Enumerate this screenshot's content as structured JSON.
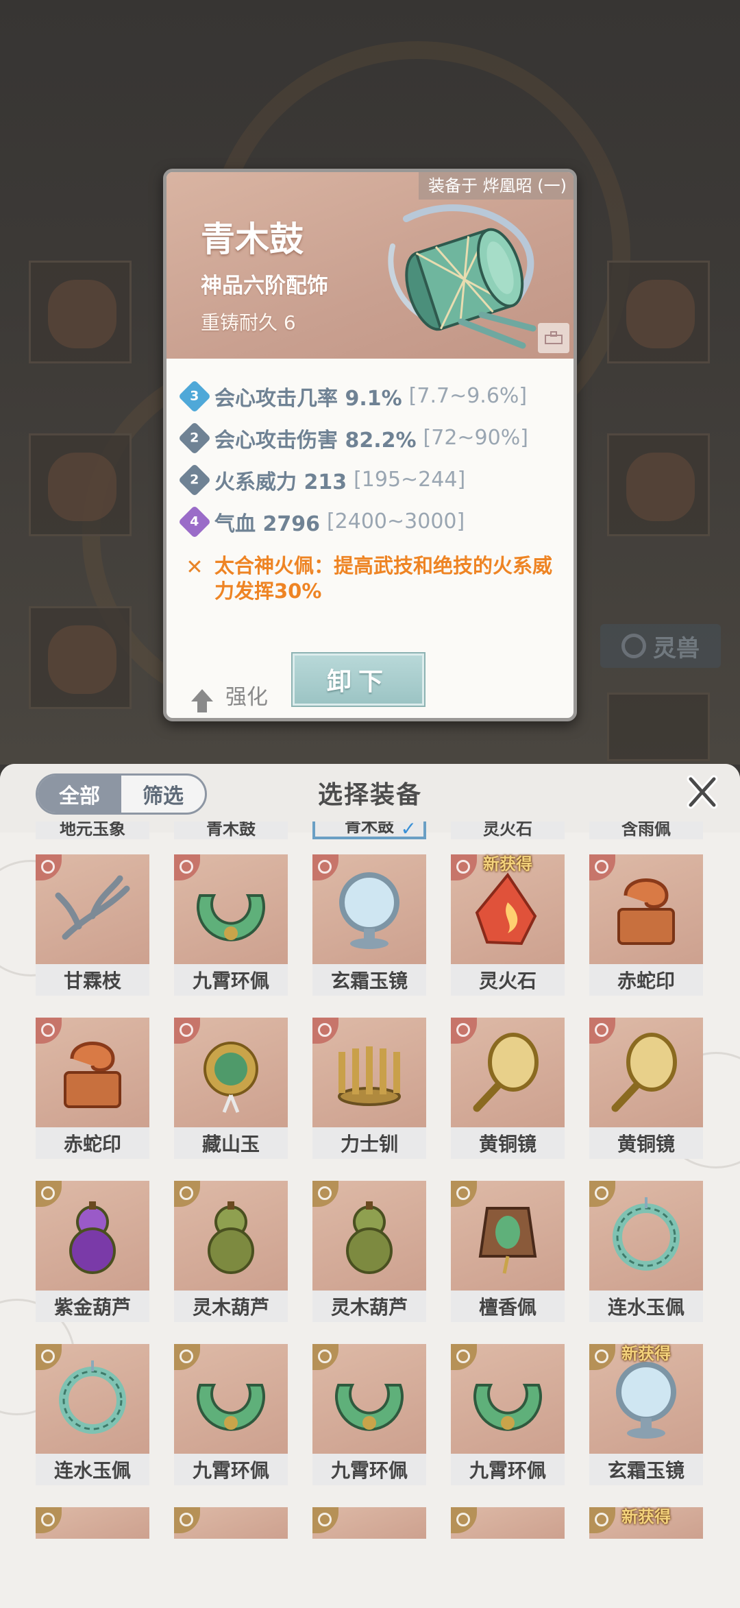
{
  "background": {
    "side_tab": {
      "label": "灵兽"
    }
  },
  "detail": {
    "equipped_on": "装备于 烨凰昭 (一)",
    "name": "青木鼓",
    "grade": "神品六阶配饰",
    "durability": "重铸耐久 6",
    "icon": "drum-icon",
    "stats": [
      {
        "level": "3",
        "color": "#4fa8d8",
        "value": "会心攻击几率 9.1%",
        "range": "[7.7~9.6%]"
      },
      {
        "level": "2",
        "color": "#6f8294",
        "value": "会心攻击伤害 82.2%",
        "range": "[72~90%]"
      },
      {
        "level": "2",
        "color": "#6f8294",
        "value": "火系威力 213",
        "range": "[195~244]"
      },
      {
        "level": "4",
        "color": "#9a6cc8",
        "value": "气血 2796",
        "range": "[2400~3000]"
      }
    ],
    "special_effect": "太合神火佩：提高武技和绝技的火系威力发挥30%",
    "enhance_label": "强化",
    "unequip_label": "卸下"
  },
  "panel": {
    "title": "选择装备",
    "filter_all": "全部",
    "filter_filter": "筛选",
    "top_row": [
      {
        "name": "地元玉象",
        "selected": false
      },
      {
        "name": "青木鼓",
        "selected": false
      },
      {
        "name": "青木鼓",
        "selected": true
      },
      {
        "name": "灵火石",
        "selected": false
      },
      {
        "name": "含雨佩",
        "selected": false
      }
    ],
    "rows": [
      [
        {
          "name": "甘霖枝",
          "badge": "red",
          "icon": "branch-icon",
          "new": ""
        },
        {
          "name": "九霄环佩",
          "badge": "red",
          "icon": "jade-ring-icon",
          "new": ""
        },
        {
          "name": "玄霜玉镜",
          "badge": "red",
          "icon": "mirror-icon",
          "new": ""
        },
        {
          "name": "灵火石",
          "badge": "red",
          "icon": "fire-stone-icon",
          "new": "新获得"
        },
        {
          "name": "赤蛇印",
          "badge": "red",
          "icon": "snake-seal-icon",
          "new": ""
        }
      ],
      [
        {
          "name": "赤蛇印",
          "badge": "red",
          "icon": "snake-seal-icon",
          "new": ""
        },
        {
          "name": "藏山玉",
          "badge": "red",
          "icon": "jade-pendant-icon",
          "new": ""
        },
        {
          "name": "力士钏",
          "badge": "red",
          "icon": "bracelet-icon",
          "new": ""
        },
        {
          "name": "黄铜镜",
          "badge": "red",
          "icon": "hand-mirror-icon",
          "new": ""
        },
        {
          "name": "黄铜镜",
          "badge": "red",
          "icon": "hand-mirror-icon",
          "new": ""
        }
      ],
      [
        {
          "name": "紫金葫芦",
          "badge": "gold",
          "icon": "gourd-icon",
          "new": ""
        },
        {
          "name": "灵木葫芦",
          "badge": "gold",
          "icon": "gourd-icon",
          "new": ""
        },
        {
          "name": "灵木葫芦",
          "badge": "gold",
          "icon": "gourd-icon",
          "new": ""
        },
        {
          "name": "檀香佩",
          "badge": "gold",
          "icon": "incense-pendant-icon",
          "new": ""
        },
        {
          "name": "连水玉佩",
          "badge": "gold",
          "icon": "water-jade-icon",
          "new": ""
        }
      ],
      [
        {
          "name": "连水玉佩",
          "badge": "gold",
          "icon": "water-jade-icon",
          "new": ""
        },
        {
          "name": "九霄环佩",
          "badge": "gold",
          "icon": "jade-ring-icon",
          "new": ""
        },
        {
          "name": "九霄环佩",
          "badge": "gold",
          "icon": "jade-ring-icon",
          "new": ""
        },
        {
          "name": "九霄环佩",
          "badge": "gold",
          "icon": "jade-ring-icon",
          "new": ""
        },
        {
          "name": "玄霜玉镜",
          "badge": "gold",
          "icon": "mirror-icon",
          "new": "新获得"
        }
      ]
    ],
    "bottom_new_tag": "新获得"
  }
}
